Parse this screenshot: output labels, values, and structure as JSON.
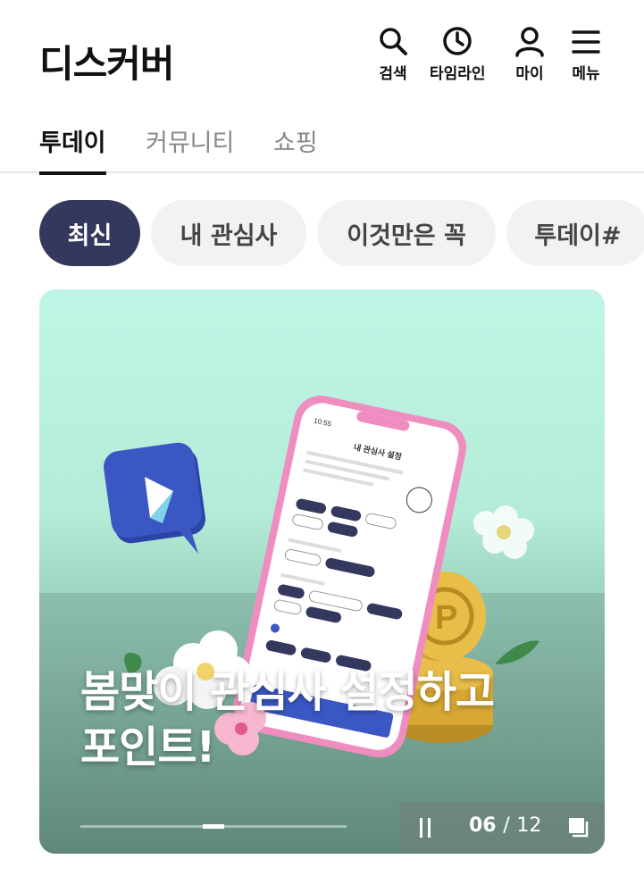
{
  "header": {
    "logo": "디스커버",
    "nav": [
      {
        "label": "검색",
        "icon": "search-icon"
      },
      {
        "label": "타임라인",
        "icon": "clock-icon"
      },
      {
        "label": "마이",
        "icon": "user-icon"
      },
      {
        "label": "메뉴",
        "icon": "menu-icon"
      }
    ]
  },
  "tabs": [
    {
      "label": "투데이",
      "active": true
    },
    {
      "label": "커뮤니티",
      "active": false
    },
    {
      "label": "쇼핑",
      "active": false
    }
  ],
  "chips": [
    {
      "label": "최신",
      "active": true
    },
    {
      "label": "내 관심사",
      "active": false
    },
    {
      "label": "이것만은 꼭",
      "active": false
    },
    {
      "label": "투데이#",
      "active": false
    }
  ],
  "banner": {
    "title_line1": "봄맞이 관심사 설정하고",
    "title_line2": "포인트!",
    "current": "06",
    "separator": "/",
    "total": "12",
    "progress": 0.5,
    "phone_screen": {
      "time": "10:55",
      "title": "내 관심사 설정"
    }
  },
  "colors": {
    "active_chip": "#34385e",
    "banner_bg": "#bff5e6",
    "phone_frame": "#f08dc0",
    "coin": "#e3b23c",
    "chat_icon": "#3b57c4"
  }
}
